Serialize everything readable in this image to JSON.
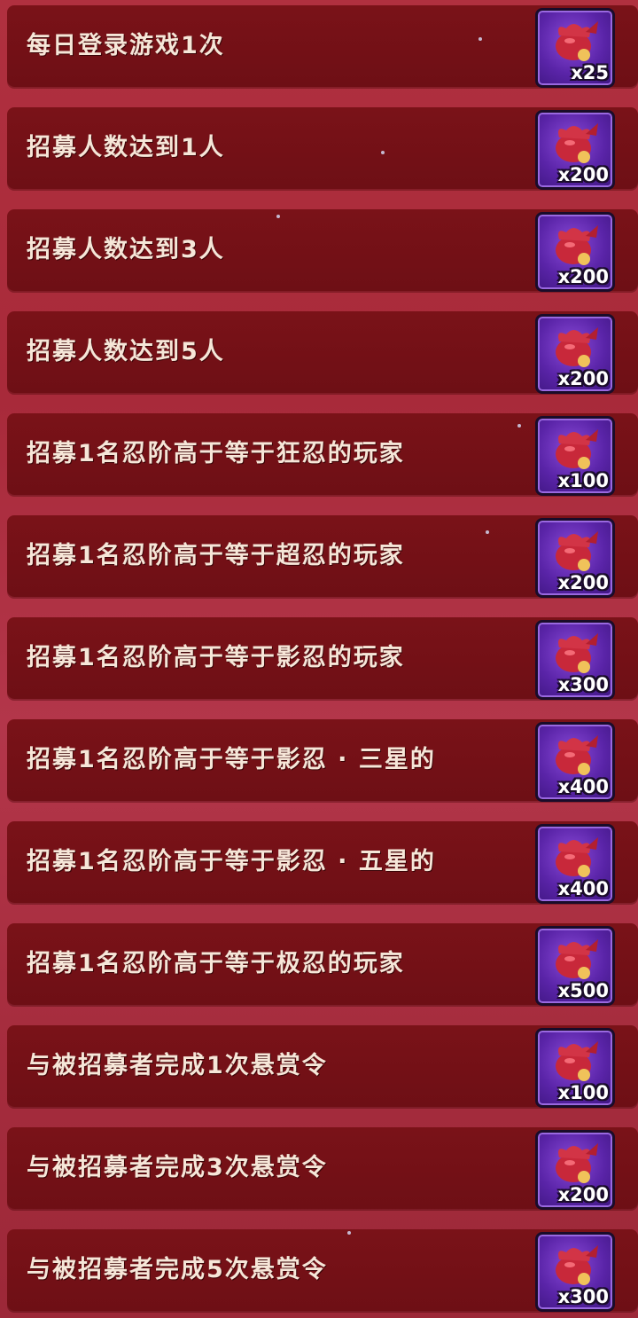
{
  "tasks": [
    {
      "label": "每日登录游戏1次",
      "reward": "x25"
    },
    {
      "label": "招募人数达到1人",
      "reward": "x200"
    },
    {
      "label": "招募人数达到3人",
      "reward": "x200"
    },
    {
      "label": "招募人数达到5人",
      "reward": "x200"
    },
    {
      "label": "招募1名忍阶高于等于狂忍的玩家",
      "reward": "x100"
    },
    {
      "label": "招募1名忍阶高于等于超忍的玩家",
      "reward": "x200"
    },
    {
      "label": "招募1名忍阶高于等于影忍的玩家",
      "reward": "x300"
    },
    {
      "label": "招募1名忍阶高于等于影忍 · 三星的",
      "reward": "x400"
    },
    {
      "label": "招募1名忍阶高于等于影忍 · 五星的",
      "reward": "x400"
    },
    {
      "label": "招募1名忍阶高于等于极忍的玩家",
      "reward": "x500"
    },
    {
      "label": "与被招募者完成1次悬赏令",
      "reward": "x100"
    },
    {
      "label": "与被招募者完成3次悬赏令",
      "reward": "x200"
    },
    {
      "label": "与被招募者完成5次悬赏令",
      "reward": "x300"
    }
  ],
  "reward_icon": "red-pouch-icon",
  "colors": {
    "row": "#74111a",
    "reward_bg": "#5a24a8",
    "text": "#f6e6d8"
  }
}
